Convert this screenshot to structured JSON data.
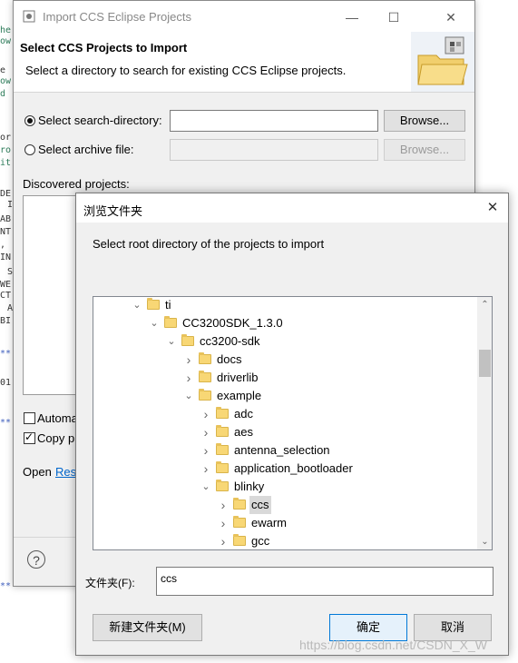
{
  "editor_fragments": [
    "he",
    "ow",
    "e",
    "ow",
    "d",
    "or",
    "ro",
    "it",
    "DE",
    "I",
    "AB",
    "NT",
    ",",
    "IN",
    "S",
    "WE",
    "CT",
    "A",
    "BI",
    "**",
    "01",
    "**",
    "**"
  ],
  "import_dialog": {
    "title": "Import CCS Eclipse Projects",
    "header_title": "Select CCS Projects to Import",
    "header_desc": "Select a directory to search for existing CCS Eclipse projects.",
    "search_dir_label": "Select search-directory:",
    "search_dir_value": "",
    "archive_label": "Select archive file:",
    "archive_value": "",
    "browse_label": "Browse...",
    "discovered_label": "Discovered projects:",
    "auto_label": "Automa",
    "copy_label": "Copy p",
    "open_label": "Open",
    "open_link": "Res",
    "help_icon": "?"
  },
  "browse_dialog": {
    "title": "浏览文件夹",
    "close_icon": "✕",
    "description": "Select root directory of the projects to import",
    "tree": [
      {
        "label": "ti",
        "level": 0,
        "state": "expanded"
      },
      {
        "label": "CC3200SDK_1.3.0",
        "level": 1,
        "state": "expanded"
      },
      {
        "label": "cc3200-sdk",
        "level": 2,
        "state": "expanded"
      },
      {
        "label": "docs",
        "level": 3,
        "state": "collapsed"
      },
      {
        "label": "driverlib",
        "level": 3,
        "state": "collapsed"
      },
      {
        "label": "example",
        "level": 3,
        "state": "expanded"
      },
      {
        "label": "adc",
        "level": 4,
        "state": "collapsed"
      },
      {
        "label": "aes",
        "level": 4,
        "state": "collapsed"
      },
      {
        "label": "antenna_selection",
        "level": 4,
        "state": "collapsed"
      },
      {
        "label": "application_bootloader",
        "level": 4,
        "state": "collapsed"
      },
      {
        "label": "blinky",
        "level": 4,
        "state": "expanded"
      },
      {
        "label": "ccs",
        "level": 5,
        "state": "collapsed",
        "selected": true
      },
      {
        "label": "ewarm",
        "level": 5,
        "state": "collapsed"
      },
      {
        "label": "gcc",
        "level": 5,
        "state": "collapsed"
      }
    ],
    "folder_label": "文件夹(F):",
    "folder_value": "ccs",
    "new_folder_label": "新建文件夹(M)",
    "ok_label": "确定",
    "cancel_label": "取消"
  },
  "watermark": "https://blog.csdn.net/CSDN_X_W"
}
